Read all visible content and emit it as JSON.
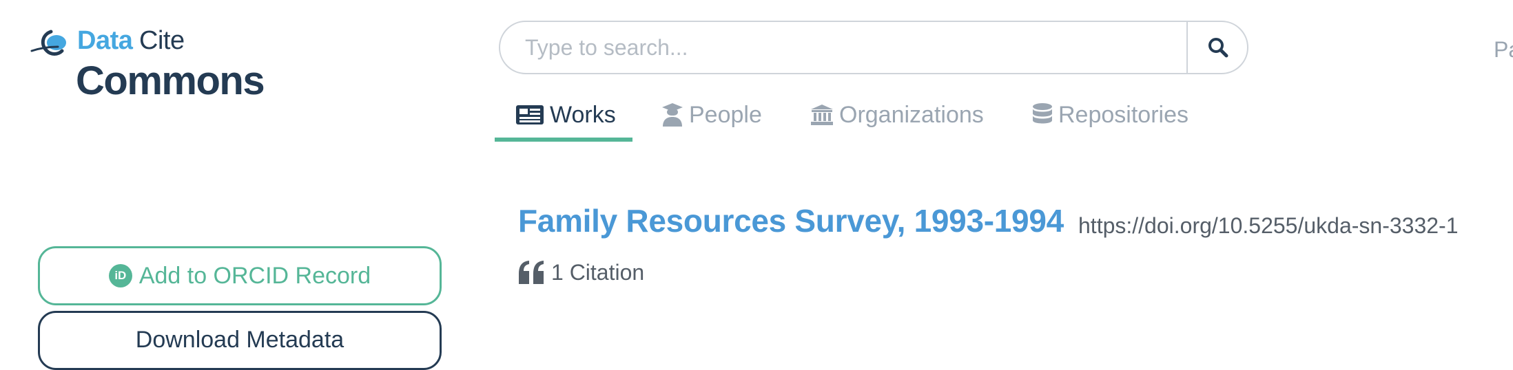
{
  "logo": {
    "word_data": "Data",
    "word_cite": "Cite",
    "word_commons": "Commons"
  },
  "search": {
    "placeholder": "Type to search..."
  },
  "header": {
    "right_cut_text": "Pa"
  },
  "tabs": [
    {
      "label": "Works",
      "icon": "newspaper-icon",
      "active": true
    },
    {
      "label": "People",
      "icon": "user-graduate-icon",
      "active": false
    },
    {
      "label": "Organizations",
      "icon": "university-icon",
      "active": false
    },
    {
      "label": "Repositories",
      "icon": "database-icon",
      "active": false
    }
  ],
  "work": {
    "title": "Family Resources Survey, 1993-1994",
    "doi": "https://doi.org/10.5255/ukda-sn-3332-1",
    "citation_text": "1 Citation"
  },
  "sidebar": {
    "orcid_badge": "iD",
    "orcid_label": "Add to ORCID Record",
    "download_label": "Download Metadata"
  },
  "colors": {
    "accent_green": "#55b697",
    "brand_blue": "#45a7e0",
    "navy": "#243b53",
    "title_blue": "#4a98d6",
    "muted": "#9aa5b1"
  }
}
